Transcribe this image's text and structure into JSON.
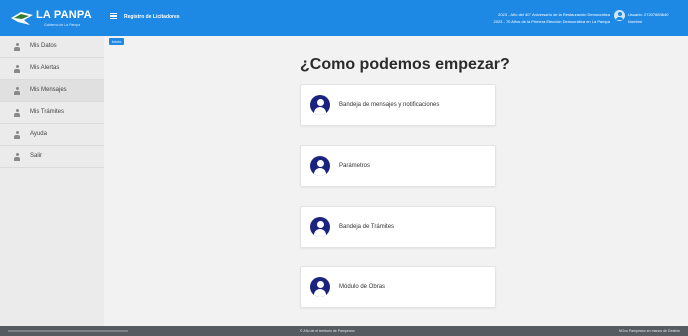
{
  "header": {
    "logo_text": "LA PANPA",
    "logo_subtitle": "Gobierno de La Pampa",
    "app_title": "Registro de Licitadores",
    "notices": [
      "2023 - Año del 40° Aniversario de la Restauración Democrática",
      "2023 - 70 Años de la Primera Elección Democrática en La Pampa"
    ],
    "user_label": "Usuario: 27207883640",
    "user_name": "Nombre"
  },
  "sidebar": {
    "items": [
      {
        "label": "Mis Datos"
      },
      {
        "label": "Mis Alertas"
      },
      {
        "label": "Mis Mensajes"
      },
      {
        "label": "Mis Trámites"
      },
      {
        "label": "Ayuda"
      },
      {
        "label": "Salir"
      }
    ]
  },
  "breadcrumb": "Inicio",
  "main": {
    "heading": "¿Como podemos empezar?",
    "cards": [
      {
        "label": "Bandeja de mensajes y notificaciones"
      },
      {
        "label": "Parámetros"
      },
      {
        "label": "Bandeja de Trámites"
      },
      {
        "label": "Módulo de Obras"
      }
    ]
  },
  "footer": {
    "center": "© Año de el territorio de Pampeano",
    "right": "NOvo Pampeano en manos de Gestión"
  },
  "colors": {
    "header_bg": "#1e88e5",
    "card_icon": "#1a237e",
    "footer_bg": "#555b61"
  }
}
